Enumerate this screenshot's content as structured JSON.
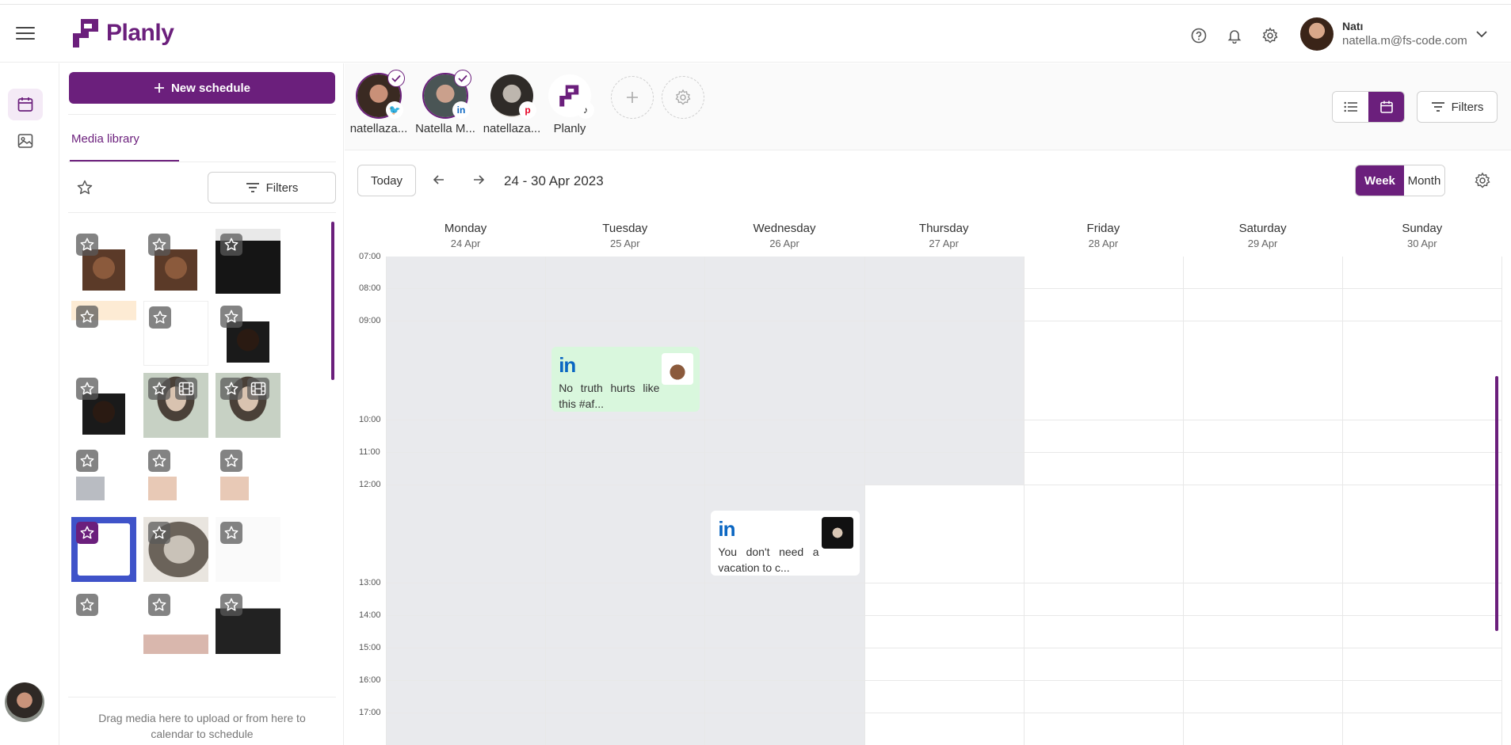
{
  "app": {
    "name": "Planly"
  },
  "user": {
    "name": "Natı",
    "email": "natella.m@fs-code.com"
  },
  "rail": {
    "items": [
      "calendar",
      "media"
    ]
  },
  "panel": {
    "new_schedule_label": "New schedule",
    "tab_label": "Media library",
    "filters_label": "Filters",
    "drag_hint": "Drag media here to upload or from here to calendar to schedule",
    "thumbs": [
      {
        "style": "will",
        "video": false
      },
      {
        "style": "will",
        "video": false
      },
      {
        "style": "leo",
        "video": false
      },
      {
        "style": "doc-orange",
        "video": false
      },
      {
        "style": "doc-blank",
        "video": false
      },
      {
        "style": "dark-face",
        "video": false
      },
      {
        "style": "dark-face",
        "video": false
      },
      {
        "style": "girl",
        "video": true
      },
      {
        "style": "girl",
        "video": true
      },
      {
        "style": "meme-cat",
        "video": false
      },
      {
        "style": "meme-pen",
        "video": false
      },
      {
        "style": "meme-pen",
        "video": false
      },
      {
        "style": "ceo",
        "video": false
      },
      {
        "style": "vintage",
        "video": false
      },
      {
        "style": "text-link",
        "video": false
      },
      {
        "style": "wrapped",
        "video": false
      },
      {
        "style": "meme-gray",
        "video": false
      },
      {
        "style": "meme-dark",
        "video": false
      }
    ]
  },
  "accounts": [
    {
      "name": "natellaza...",
      "network": "twitter",
      "checked": true
    },
    {
      "name": "Natella M...",
      "network": "linkedin",
      "checked": true
    },
    {
      "name": "natellaza...",
      "network": "pinterest",
      "checked": false
    },
    {
      "name": "Planly",
      "network": "tiktok",
      "checked": false
    }
  ],
  "toolbar": {
    "filters_label": "Filters",
    "today_label": "Today",
    "date_range": "24 - 30 Apr 2023",
    "week_label": "Week",
    "month_label": "Month",
    "active_view": "Week"
  },
  "calendar": {
    "days": [
      {
        "name": "Monday",
        "date": "24 Apr"
      },
      {
        "name": "Tuesday",
        "date": "25 Apr"
      },
      {
        "name": "Wednesday",
        "date": "26 Apr"
      },
      {
        "name": "Thursday",
        "date": "27 Apr"
      },
      {
        "name": "Friday",
        "date": "28 Apr"
      },
      {
        "name": "Saturday",
        "date": "29 Apr"
      },
      {
        "name": "Sunday",
        "date": "30 Apr"
      }
    ],
    "times": [
      "07:00",
      "08:00",
      "09:00",
      "10:00",
      "11:00",
      "12:00",
      "13:00",
      "14:00",
      "15:00",
      "16:00",
      "17:00"
    ],
    "posts": [
      {
        "day": "Tuesday",
        "network": "LinkedIn",
        "network_mark": "in",
        "text": "No truth hurts like this #af...",
        "color": "#d9f7dd"
      },
      {
        "day": "Wednesday",
        "network": "LinkedIn",
        "network_mark": "in",
        "text": "You don't need a vacation to c...",
        "color": "#ffffff"
      }
    ]
  },
  "colors": {
    "brand": "#6b1f7c",
    "past_day": "#e9eaed",
    "linkedin": "#0a66c2"
  }
}
